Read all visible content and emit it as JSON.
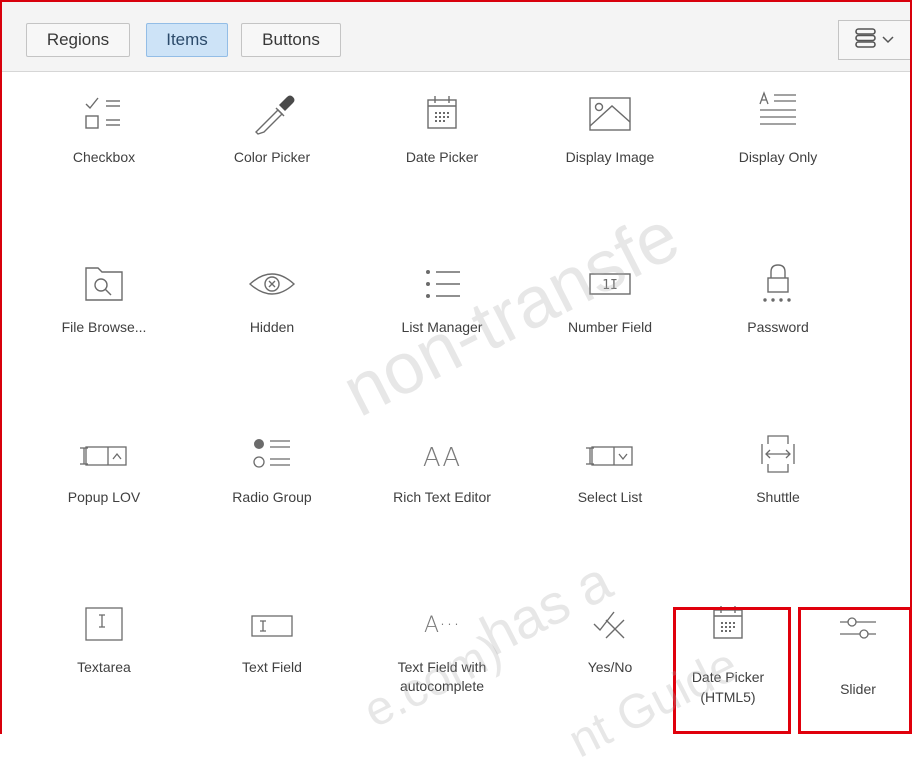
{
  "tabs": [
    {
      "label": "Regions",
      "active": false
    },
    {
      "label": "Items",
      "active": true
    },
    {
      "label": "Buttons",
      "active": false
    }
  ],
  "view_toggle": {
    "icon": "list-view-icon",
    "chevron": "chevron-down-icon"
  },
  "items": [
    {
      "label": "Checkbox",
      "icon": "checkbox-icon"
    },
    {
      "label": "Color Picker",
      "icon": "color-picker-icon"
    },
    {
      "label": "Date Picker",
      "icon": "date-picker-icon"
    },
    {
      "label": "Display Image",
      "icon": "display-image-icon"
    },
    {
      "label": "Display Only",
      "icon": "display-only-icon"
    },
    {
      "label": "File Browse...",
      "icon": "file-browse-icon"
    },
    {
      "label": "Hidden",
      "icon": "hidden-icon"
    },
    {
      "label": "List Manager",
      "icon": "list-manager-icon"
    },
    {
      "label": "Number Field",
      "icon": "number-field-icon"
    },
    {
      "label": "Password",
      "icon": "password-icon"
    },
    {
      "label": "Popup LOV",
      "icon": "popup-lov-icon"
    },
    {
      "label": "Radio Group",
      "icon": "radio-group-icon"
    },
    {
      "label": "Rich Text Editor",
      "icon": "rich-text-editor-icon"
    },
    {
      "label": "Select List",
      "icon": "select-list-icon"
    },
    {
      "label": "Shuttle",
      "icon": "shuttle-icon"
    },
    {
      "label": "Textarea",
      "icon": "textarea-icon"
    },
    {
      "label": "Text Field",
      "icon": "text-field-icon"
    },
    {
      "label": "Text Field with autocomplete",
      "line1": "Text Field with",
      "line2": "autocomplete",
      "icon": "text-field-autocomplete-icon"
    },
    {
      "label": "Yes/No",
      "icon": "yes-no-icon"
    },
    {
      "label": "Date Picker (HTML5)",
      "line1": "Date Picker",
      "line2": "(HTML5)",
      "icon": "date-picker-html5-icon",
      "highlighted": true
    },
    {
      "label": "Slider",
      "icon": "slider-icon",
      "highlighted": true
    }
  ],
  "icon_glyphs": {
    "number_field": "1I",
    "select_chevron": "⌄",
    "autocomplete": "A···",
    "rich_text": "AA"
  },
  "watermark": {
    "line1": "non-transfe",
    "line2": "has a",
    "line3": "e.com)"
  },
  "watermark_guide": "nt Guide",
  "colors": {
    "highlight": "#e0000c",
    "active_tab": "#cde3f7",
    "icon_stroke": "#6b6b6b"
  }
}
